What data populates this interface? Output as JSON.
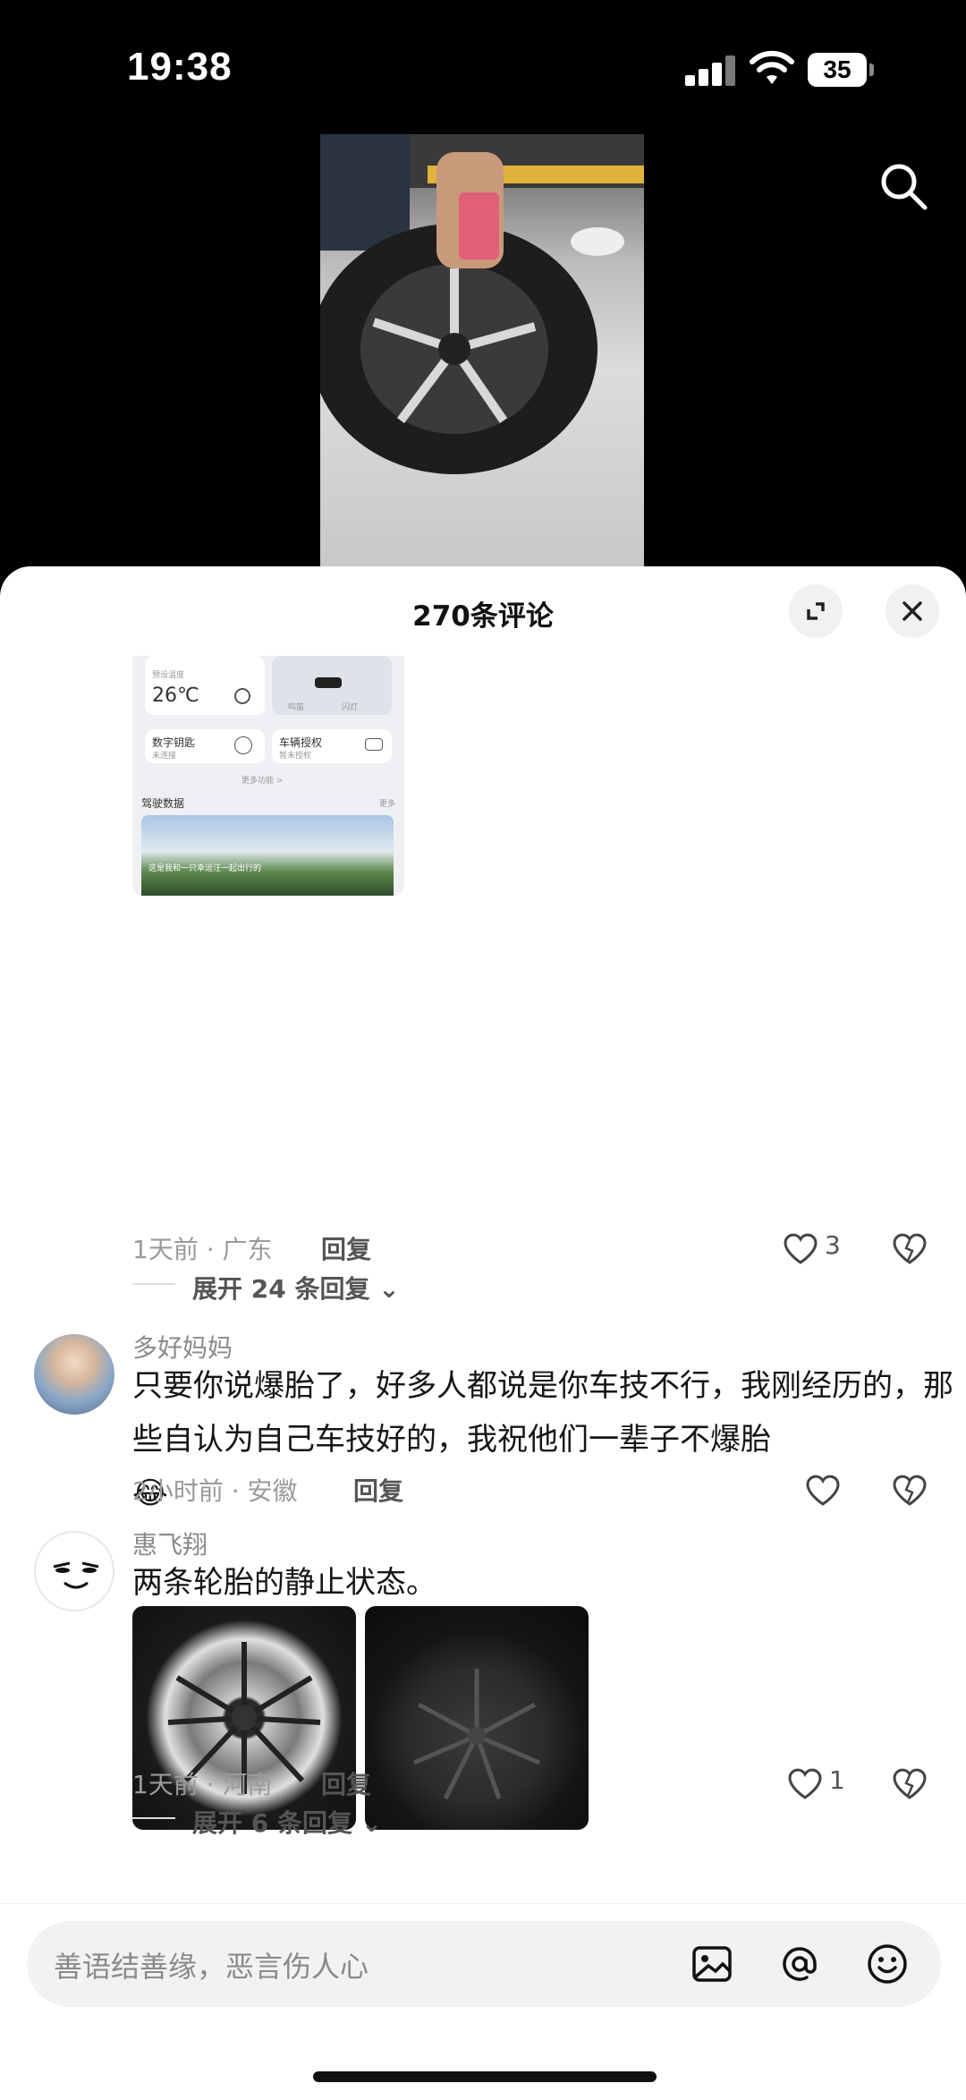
{
  "status_bar": {
    "time": "19:38",
    "battery": "35"
  },
  "sheet": {
    "title": "270条评论"
  },
  "embedded_screenshot": {
    "temp_label": "预设温度",
    "temp_value": "26℃",
    "key_label": "数字钥匙",
    "key_sub": "未连接",
    "auth_label": "车辆授权",
    "auth_sub": "暂未授权",
    "more_features": "更多功能 >",
    "driving_data": "驾驶数据",
    "more": "更多",
    "map_btn_1": "鸣笛",
    "map_btn_2": "闪灯",
    "photo_caption": "这是我和一只幸运汪一起出行的"
  },
  "comments": [
    {
      "meta": "1天前 · 广东",
      "reply_label": "回复",
      "likes": "3",
      "expand_label": "展开 24 条回复"
    },
    {
      "username": "多好妈妈",
      "text": "只要你说爆胎了，好多人都说是你车技不行，我刚经历的，那些自认为自己车技好的，我祝他们一辈子不爆胎",
      "emoji": "😂",
      "meta": "2小时前 · 安徽",
      "reply_label": "回复"
    },
    {
      "username": "惠飞翔",
      "text": "两条轮胎的静止状态。",
      "meta": "1天前 · 河南",
      "reply_label": "回复",
      "likes": "1",
      "expand_label": "展开 6 条回复"
    }
  ],
  "input": {
    "placeholder": "善语结善缘，恶言伤人心"
  }
}
